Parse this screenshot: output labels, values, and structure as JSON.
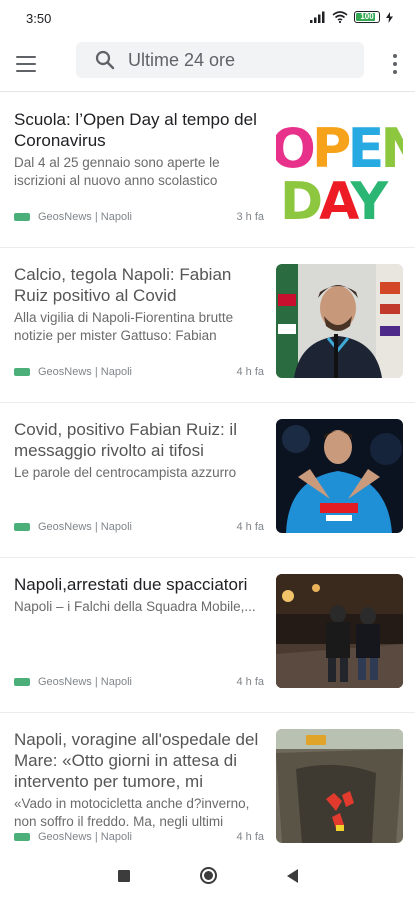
{
  "status_bar": {
    "time": "3:50",
    "battery": "100"
  },
  "search": {
    "text": "Ultime 24 ore"
  },
  "articles": [
    {
      "title": "Scuola: l’Open Day al tempo del Coronavirus",
      "snippet": "Dal 4 al 25 gennaio sono aperte le iscrizioni al nuovo anno scolastico",
      "source": "GeosNews | Napoli",
      "time": "3 h fa",
      "image_text_1": "OPEN",
      "image_text_2": "DAY"
    },
    {
      "title": "Calcio, tegola Napoli: Fabian Ruiz positivo al Covid",
      "snippet": "Alla vigilia di Napoli-Fiorentina brutte notizie per mister Gattuso: Fabian",
      "source": "GeosNews | Napoli",
      "time": "4 h fa"
    },
    {
      "title": "Covid, positivo Fabian Ruiz: il messaggio rivolto ai tifosi",
      "snippet": "Le parole del centrocampista azzurro",
      "source": "GeosNews | Napoli",
      "time": "4 h fa"
    },
    {
      "title": "Napoli,arrestati due spacciatori",
      "snippet": "Napoli – i Falchi della Squadra Mobile,...",
      "source": "GeosNews | Napoli",
      "time": "4 h fa"
    },
    {
      "title": "Napoli, voragine all'ospedale del Mare: «Otto giorni in attesa di intervento per tumore, mi",
      "snippet": "«Vado in motocicletta anche d?inverno, non soffro il freddo. Ma, negli ultimi",
      "source": "GeosNews | Napoli",
      "time": "4 h fa"
    }
  ],
  "colors": {
    "source_tag": "#4caf7a",
    "search_bg": "#f1f3f4"
  }
}
